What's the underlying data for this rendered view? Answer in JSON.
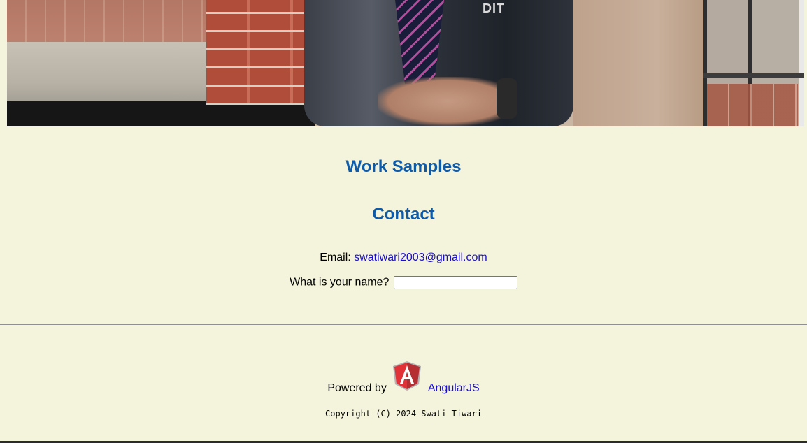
{
  "hero": {
    "badge_text": "DIT"
  },
  "sections": {
    "work_samples_title": "Work Samples",
    "contact_title": "Contact"
  },
  "contact": {
    "email_label": "Email:",
    "email_value": "swatiwari2003@gmail.com",
    "name_prompt": "What is your name?",
    "name_input_value": ""
  },
  "footer": {
    "powered_by_label": "Powered by",
    "framework_link": "AngularJS",
    "logo_icon": "angularjs-logo-icon",
    "copyright": "Copyright (C) 2024 Swati Tiwari"
  },
  "colors": {
    "background": "#f4f4dc",
    "heading": "#0e5aa7",
    "link": "#1a0dcc"
  }
}
